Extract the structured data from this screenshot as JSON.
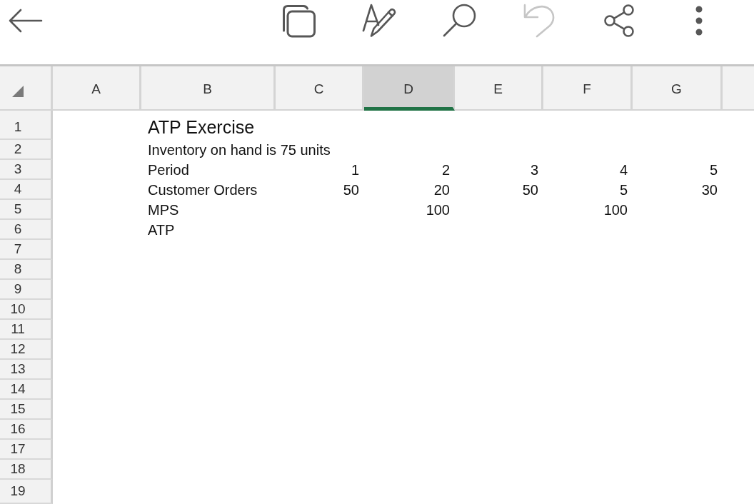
{
  "toolbar": {
    "buttons": [
      {
        "kind": "back",
        "disabled": false
      },
      {
        "kind": "copy",
        "disabled": false
      },
      {
        "kind": "format",
        "disabled": false
      },
      {
        "kind": "search",
        "disabled": false
      },
      {
        "kind": "undo",
        "disabled": true
      },
      {
        "kind": "share",
        "disabled": false
      },
      {
        "kind": "more",
        "disabled": false
      }
    ]
  },
  "sheet": {
    "columns": [
      {
        "label": "A",
        "selected": false
      },
      {
        "label": "B",
        "selected": false
      },
      {
        "label": "C",
        "selected": false
      },
      {
        "label": "D",
        "selected": true
      },
      {
        "label": "E",
        "selected": false
      },
      {
        "label": "F",
        "selected": false
      },
      {
        "label": "G",
        "selected": false
      }
    ],
    "rows": [
      {
        "label": "1",
        "selected": false,
        "cells": [
          {
            "kind": "empty"
          },
          {
            "kind": "title",
            "text": "ATP Exercise"
          },
          {
            "kind": "empty"
          },
          {
            "kind": "empty"
          },
          {
            "kind": "empty"
          },
          {
            "kind": "empty"
          },
          {
            "kind": "empty"
          }
        ]
      },
      {
        "label": "2",
        "selected": false,
        "cells": [
          {
            "kind": "empty"
          },
          {
            "kind": "text",
            "text": "Inventory on hand is 75 units"
          },
          {
            "kind": "empty"
          },
          {
            "kind": "empty"
          },
          {
            "kind": "empty"
          },
          {
            "kind": "empty"
          },
          {
            "kind": "empty"
          }
        ]
      },
      {
        "label": "3",
        "selected": false,
        "cells": [
          {
            "kind": "empty"
          },
          {
            "kind": "text",
            "text": "Period"
          },
          {
            "kind": "number",
            "text": "1"
          },
          {
            "kind": "number",
            "text": "2"
          },
          {
            "kind": "number",
            "text": "3"
          },
          {
            "kind": "number",
            "text": "4"
          },
          {
            "kind": "number",
            "text": "5"
          }
        ]
      },
      {
        "label": "4",
        "selected": false,
        "cells": [
          {
            "kind": "empty"
          },
          {
            "kind": "text",
            "text": "Customer Orders"
          },
          {
            "kind": "number",
            "text": "50"
          },
          {
            "kind": "number",
            "text": "20"
          },
          {
            "kind": "number",
            "text": "50"
          },
          {
            "kind": "number",
            "text": "5"
          },
          {
            "kind": "number",
            "text": "30"
          }
        ]
      },
      {
        "label": "5",
        "selected": false,
        "cells": [
          {
            "kind": "empty"
          },
          {
            "kind": "text",
            "text": "MPS"
          },
          {
            "kind": "empty"
          },
          {
            "kind": "number",
            "text": "100"
          },
          {
            "kind": "empty"
          },
          {
            "kind": "number",
            "text": "100"
          },
          {
            "kind": "empty"
          }
        ]
      },
      {
        "label": "6",
        "selected": false,
        "cells": [
          {
            "kind": "empty"
          },
          {
            "kind": "text",
            "text": "ATP"
          },
          {
            "kind": "empty"
          },
          {
            "kind": "empty"
          },
          {
            "kind": "empty"
          },
          {
            "kind": "empty"
          },
          {
            "kind": "empty"
          }
        ]
      },
      {
        "label": "7",
        "selected": false
      },
      {
        "label": "8",
        "selected": false
      },
      {
        "label": "9",
        "selected": false
      },
      {
        "label": "10",
        "selected": false
      },
      {
        "label": "11",
        "selected": false
      },
      {
        "label": "12",
        "selected": false
      },
      {
        "label": "13",
        "selected": false
      },
      {
        "label": "14",
        "selected": false
      },
      {
        "label": "15",
        "selected": false
      },
      {
        "label": "16",
        "selected": false
      },
      {
        "label": "17",
        "selected": false
      },
      {
        "label": "18",
        "selected": false
      },
      {
        "label": "19",
        "selected": false
      }
    ]
  }
}
